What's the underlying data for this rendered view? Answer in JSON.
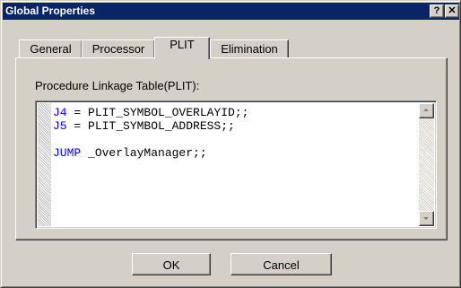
{
  "window": {
    "title": "Global Properties",
    "help_label": "?",
    "close_label": "✕",
    "titlebar_color": "#0a246a"
  },
  "tabs": [
    {
      "label": "General",
      "selected": false
    },
    {
      "label": "Processor",
      "selected": false
    },
    {
      "label": "PLIT",
      "selected": true
    },
    {
      "label": "Elimination",
      "selected": false
    }
  ],
  "plit": {
    "field_label": "Procedure Linkage Table(PLIT):",
    "code_lines": [
      {
        "keyword": "J4",
        "rest": " = PLIT_SYMBOL_OVERLAYID;;"
      },
      {
        "keyword": "J5",
        "rest": " = PLIT_SYMBOL_ADDRESS;;"
      },
      {
        "keyword": "",
        "rest": ""
      },
      {
        "keyword": "JUMP",
        "rest": " _OverlayManager;;"
      }
    ],
    "keyword_color": "#0000ff"
  },
  "buttons": {
    "ok_label": "OK",
    "cancel_label": "Cancel"
  }
}
